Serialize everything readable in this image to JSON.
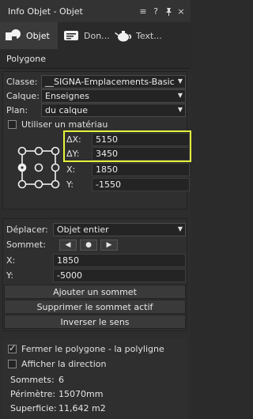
{
  "window": {
    "title": "Info Objet - Objet",
    "buttons": [
      "≡",
      "?",
      "🖈",
      "×"
    ]
  },
  "tabs": [
    {
      "label": "Objet",
      "icon": "object-shapes-icon",
      "active": true
    },
    {
      "label": "Don...",
      "icon": "data-card-icon",
      "active": false
    },
    {
      "label": "Text...",
      "icon": "teapot-icon",
      "active": false
    }
  ],
  "object_type": "Polygone",
  "props": {
    "classe_label": "Classe:",
    "classe_value": "__SIGNA-Emplacements-Basic",
    "calque_label": "Calque:",
    "calque_value": "Enseignes",
    "plan_label": "Plan:",
    "plan_value": "du calque",
    "material_label": "Utiliser un matériau",
    "material_checked": false
  },
  "geometry": {
    "dx_label": "ΔX:",
    "dx_value": "5150",
    "dy_label": "ΔY:",
    "dy_value": "3450",
    "x_label": "X:",
    "x_value": "1850",
    "y_label": "Y:",
    "y_value": "-1550",
    "highlight_color": "#e5f53a"
  },
  "move": {
    "deplacer_label": "Déplacer:",
    "deplacer_value": "Objet entier",
    "sommet_label": "Sommet:",
    "nav_prev": "◀",
    "nav_cur": "●",
    "nav_next": "▶",
    "x_label": "X:",
    "x_value": "1850",
    "y_label": "Y:",
    "y_value": "-5000",
    "add_vertex": "Ajouter un sommet",
    "delete_vertex": "Supprimer le sommet actif",
    "reverse": "Inverser le sens"
  },
  "options": {
    "close_polygon_label": "Fermer le polygone - la polyligne",
    "close_polygon_checked": true,
    "show_direction_label": "Afficher la direction",
    "show_direction_checked": false
  },
  "stats": {
    "sommets_label": "Sommets:",
    "sommets_value": "6",
    "perimetre_label": "Périmètre:",
    "perimetre_value": "15070mm",
    "superficie_label": "Superficie:",
    "superficie_value": "11,642 m2"
  }
}
